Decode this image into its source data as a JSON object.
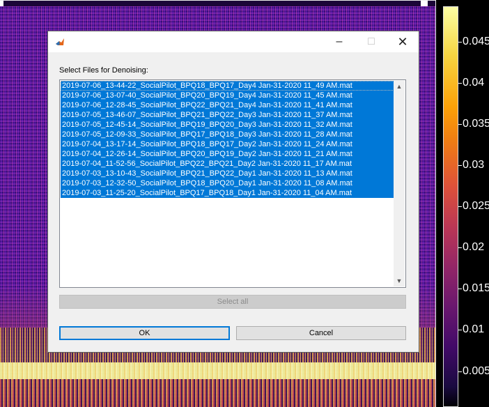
{
  "colorbar": {
    "labels": [
      "0.045",
      "0.04",
      "0.035",
      "0.03",
      "0.025",
      "0.02",
      "0.015",
      "0.01",
      "0.005"
    ]
  },
  "dialog": {
    "prompt": "Select Files for Denoising:",
    "files": [
      "2019-07-06_13-44-22_SocialPilot_BPQ18_BPQ17_Day4 Jan-31-2020 11_49 AM.mat",
      "2019-07-06_13-07-40_SocialPilot_BPQ20_BPQ19_Day4 Jan-31-2020 11_45 AM.mat",
      "2019-07-06_12-28-45_SocialPilot_BPQ22_BPQ21_Day4 Jan-31-2020 11_41 AM.mat",
      "2019-07-05_13-46-07_SocialPilot_BPQ21_BPQ22_Day3 Jan-31-2020 11_37 AM.mat",
      "2019-07-05_12-45-14_SocialPilot_BPQ19_BPQ20_Day3 Jan-31-2020 11_32 AM.mat",
      "2019-07-05_12-09-33_SocialPilot_BPQ17_BPQ18_Day3 Jan-31-2020 11_28 AM.mat",
      "2019-07-04_13-17-14_SocialPilot_BPQ18_BPQ17_Day2 Jan-31-2020 11_24 AM.mat",
      "2019-07-04_12-26-14_SocialPilot_BPQ20_BPQ19_Day2 Jan-31-2020 11_21 AM.mat",
      "2019-07-04_11-52-56_SocialPilot_BPQ22_BPQ21_Day2 Jan-31-2020 11_17 AM.mat",
      "2019-07-03_13-10-43_SocialPilot_BPQ21_BPQ22_Day1 Jan-31-2020 11_13 AM.mat",
      "2019-07-03_12-32-50_SocialPilot_BPQ18_BPQ20_Day1 Jan-31-2020 11_08 AM.mat",
      "2019-07-03_11-25-20_SocialPilot_BPQ17_BPQ18_Day1 Jan-31-2020 11_04 AM.mat"
    ],
    "select_all_label": "Select all",
    "ok_label": "OK",
    "cancel_label": "Cancel",
    "selection_color": "#0078d7"
  },
  "icons": {
    "minimize": "minimize-icon",
    "maximize": "maximize-icon",
    "close": "close-icon",
    "app": "matlab-icon"
  }
}
